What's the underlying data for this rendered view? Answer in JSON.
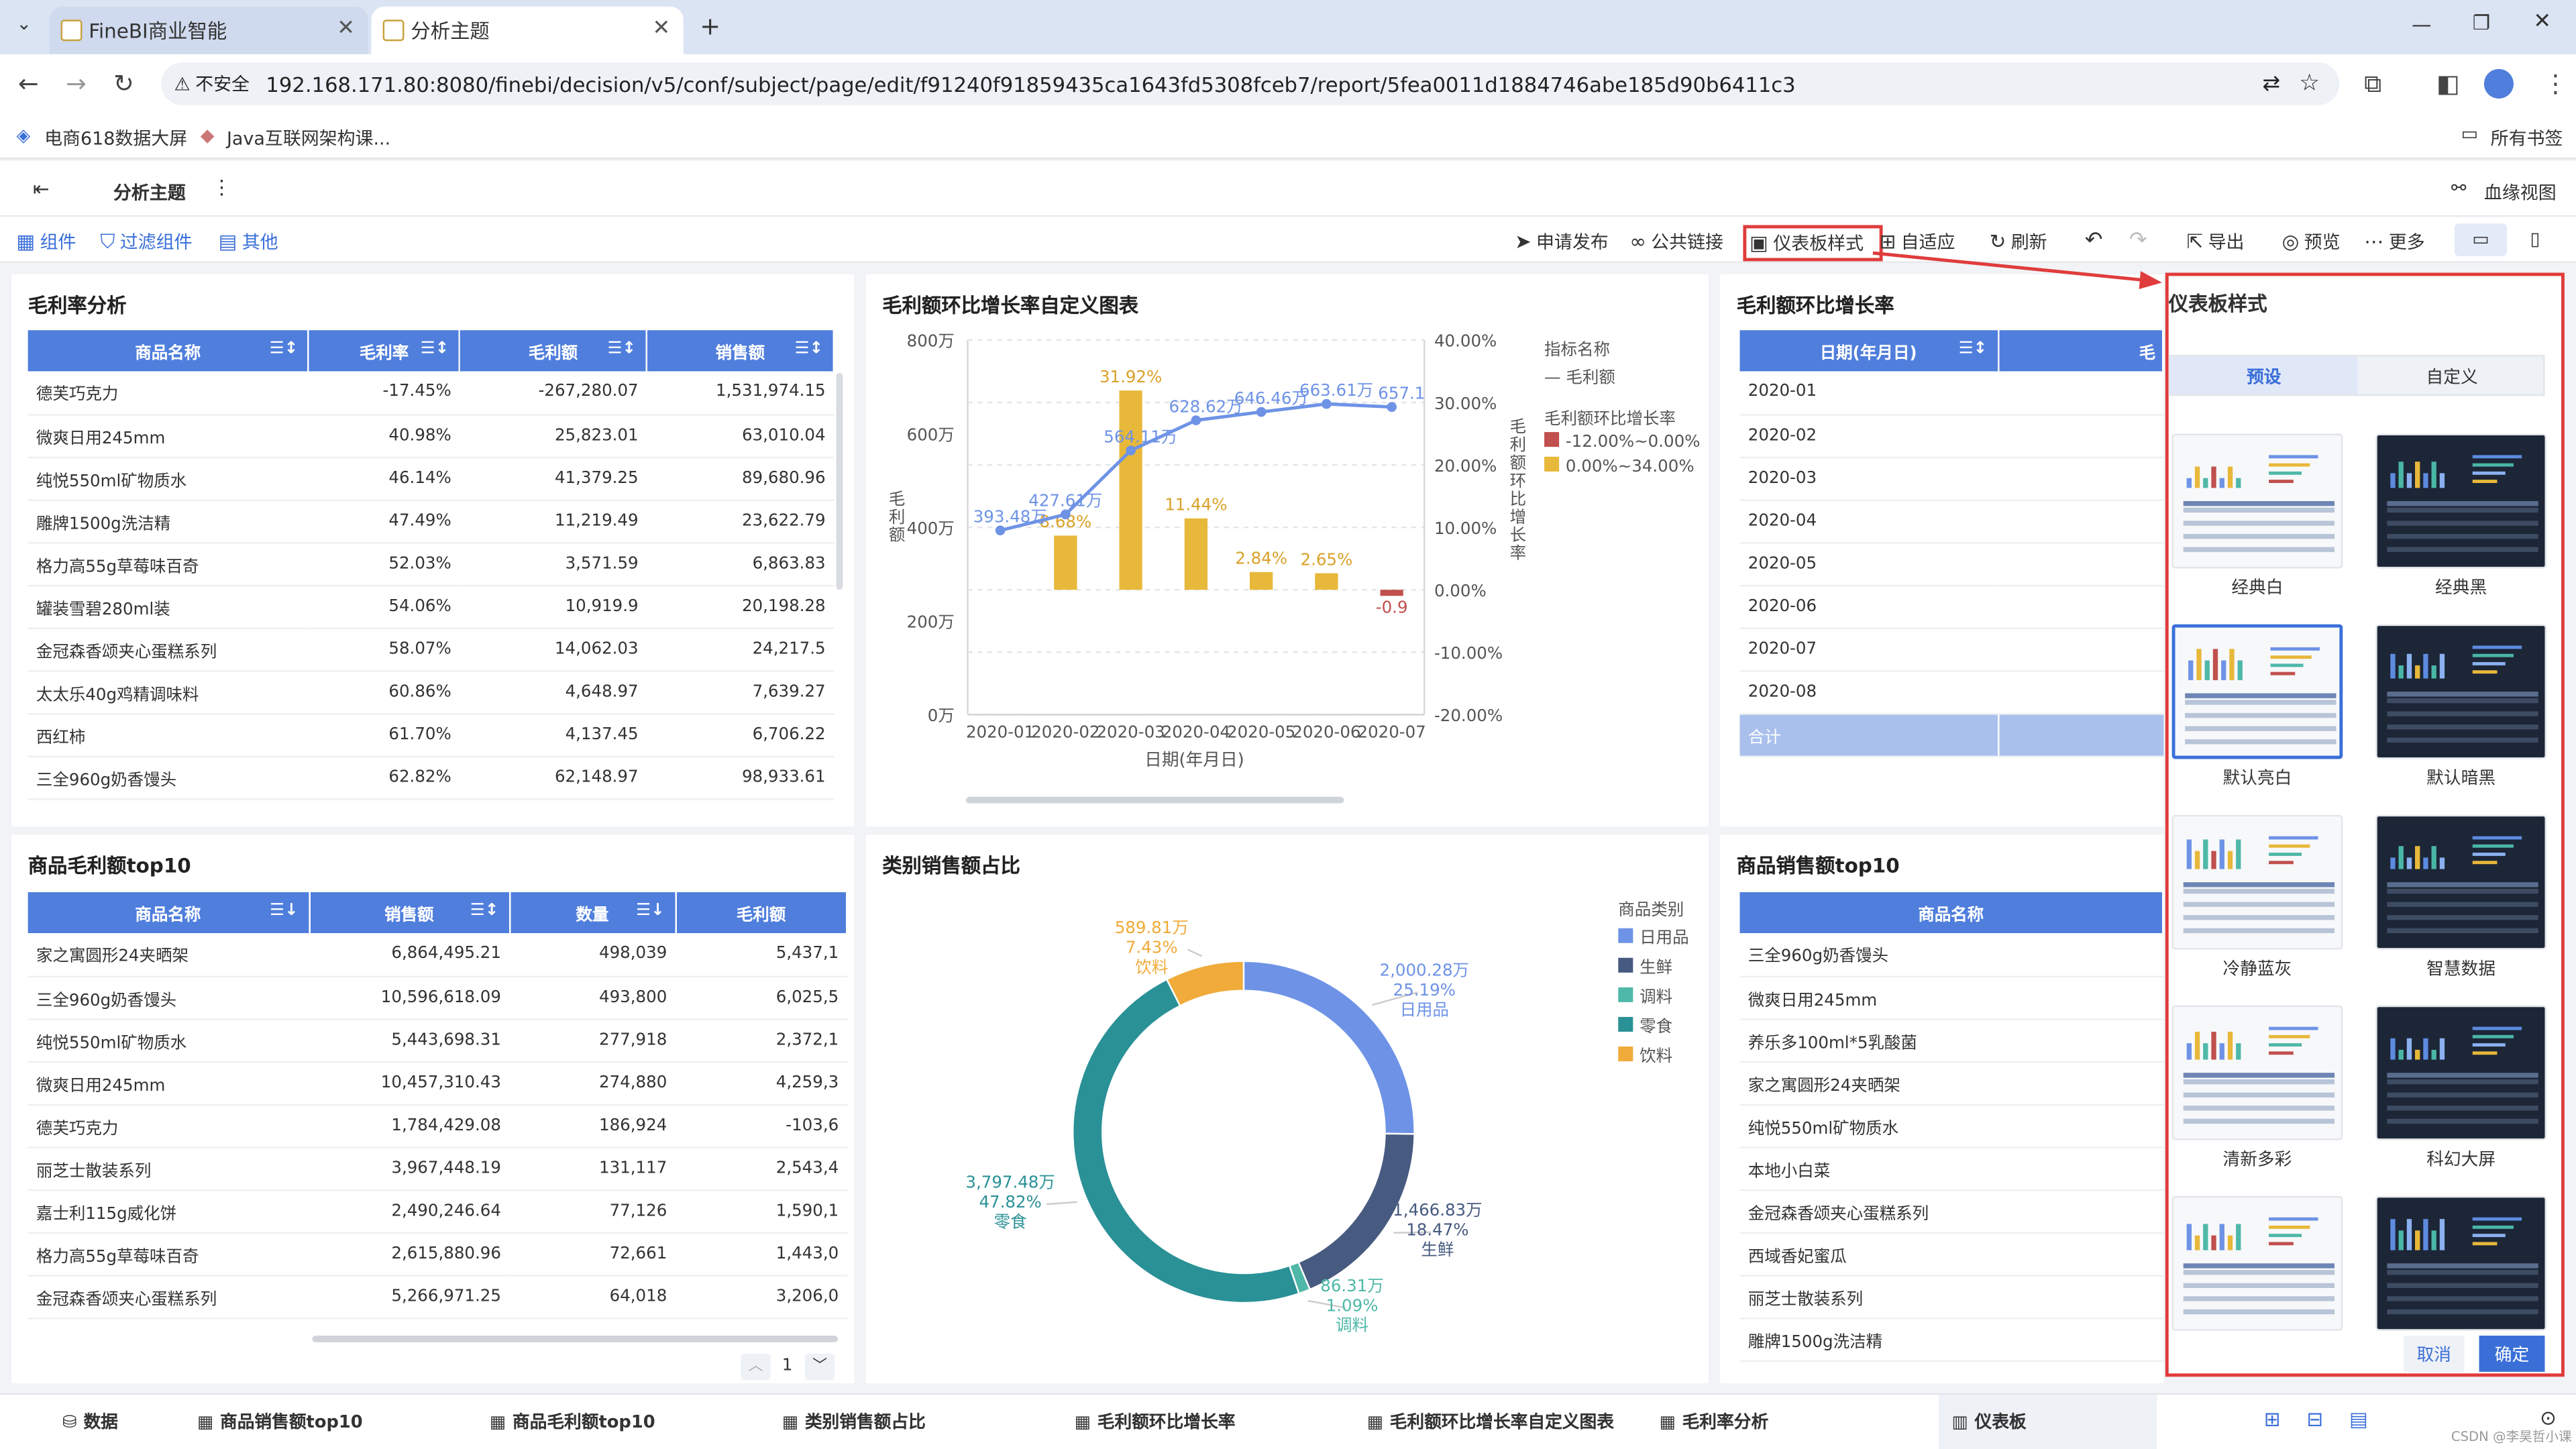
{
  "browser": {
    "tabs": [
      {
        "label": "FineBI商业智能"
      },
      {
        "label": "分析主题"
      }
    ],
    "insecure_label": "不安全",
    "url": "192.168.171.80:8080/finebi/decision/v5/conf/subject/page/edit/f91240f91859435ca1643fd5308fceb7/report/5fea0011d1884746abe185d90b6411c3",
    "bookmarks": [
      "电商618数据大屏",
      "Java互联网架构课..."
    ],
    "all_bookmarks": "所有书签"
  },
  "app": {
    "title": "分析主题",
    "lineage": "血缘视图"
  },
  "toolbar": {
    "left": [
      "组件",
      "过滤组件",
      "其他"
    ],
    "right": [
      "申请发布",
      "公共链接",
      "仪表板样式",
      "自适应",
      "刷新",
      "导出",
      "预览",
      "更多"
    ]
  },
  "gross_margin": {
    "title": "毛利率分析",
    "columns": [
      "商品名称",
      "毛利率",
      "毛利额",
      "销售额"
    ],
    "rows": [
      [
        "德芙巧克力",
        "-17.45%",
        "-267,280.07",
        "1,531,974.15"
      ],
      [
        "微爽日用245mm",
        "40.98%",
        "25,823.01",
        "63,010.04"
      ],
      [
        "纯悦550ml矿物质水",
        "46.14%",
        "41,379.25",
        "89,680.96"
      ],
      [
        "雕牌1500g洗洁精",
        "47.49%",
        "11,219.49",
        "23,622.79"
      ],
      [
        "格力高55g草莓味百奇",
        "52.03%",
        "3,571.59",
        "6,863.83"
      ],
      [
        "罐装雪碧280ml装",
        "54.06%",
        "10,919.9",
        "20,198.28"
      ],
      [
        "金冠森香颂夹心蛋糕系列",
        "58.07%",
        "14,062.03",
        "24,217.5"
      ],
      [
        "太太乐40g鸡精调味料",
        "60.86%",
        "4,648.97",
        "7,639.27"
      ],
      [
        "西红柿",
        "61.70%",
        "4,137.45",
        "6,706.22"
      ],
      [
        "三全960g奶香馒头",
        "62.82%",
        "62,148.97",
        "98,933.61"
      ]
    ]
  },
  "custom_chart": {
    "title": "毛利额环比增长率自定义图表",
    "xlabel": "日期(年月日)",
    "ylabel": "毛利额",
    "y2label": "毛利额环比增长率",
    "legend_title": "指标名称",
    "legend_line": "毛利额",
    "legend_bar_title": "毛利额环比增长率",
    "legend_bar_items": [
      "-12.00%~0.00%",
      "0.00%~34.00%"
    ],
    "left_ticks": [
      "800万",
      "600万",
      "400万",
      "200万",
      "0万"
    ],
    "right_ticks": [
      "40.00%",
      "30.00%",
      "20.00%",
      "10.00%",
      "0.00%",
      "-10.00%",
      "-20.00%"
    ]
  },
  "chart_data": {
    "type": "bar",
    "categories": [
      "2020-01",
      "2020-02",
      "2020-03",
      "2020-04",
      "2020-05",
      "2020-06",
      "2020-07"
    ],
    "series": [
      {
        "name": "毛利额",
        "type": "line",
        "values": [
          393.48,
          427.61,
          564.11,
          628.62,
          646.46,
          663.61,
          657.1
        ],
        "labels": [
          "393.48万",
          "427.61万",
          "564.11万",
          "628.62万",
          "646.46万",
          "663.61万",
          "657.1"
        ]
      },
      {
        "name": "毛利额环比增长率",
        "type": "bar",
        "values": [
          null,
          8.68,
          31.92,
          11.44,
          2.84,
          2.65,
          -0.97
        ],
        "labels": [
          "",
          "8.68%",
          "31.92%",
          "11.44%",
          "2.84%",
          "2.65%",
          "-0.9"
        ]
      }
    ],
    "ylim": [
      0,
      800
    ],
    "y2lim": [
      -20,
      40
    ],
    "colors": {
      "line": "#6e93e6",
      "bar_pos": "#e8b83a",
      "bar_neg": "#c0504d"
    }
  },
  "growth_rate": {
    "title": "毛利额环比增长率",
    "column": "日期(年月日)",
    "column2": "毛",
    "rows": [
      "2020-01",
      "2020-02",
      "2020-03",
      "2020-04",
      "2020-05",
      "2020-06",
      "2020-07",
      "2020-08"
    ],
    "total": "合计"
  },
  "top10_margin": {
    "title": "商品毛利额top10",
    "columns": [
      "商品名称",
      "销售额",
      "数量",
      "毛利额"
    ],
    "rows": [
      [
        "家之寓圆形24夹晒架",
        "6,864,495.21",
        "498,039",
        "5,437,1"
      ],
      [
        "三全960g奶香馒头",
        "10,596,618.09",
        "493,800",
        "6,025,5"
      ],
      [
        "纯悦550ml矿物质水",
        "5,443,698.31",
        "277,918",
        "2,372,1"
      ],
      [
        "微爽日用245mm",
        "10,457,310.43",
        "274,880",
        "4,259,3"
      ],
      [
        "德芙巧克力",
        "1,784,429.08",
        "186,924",
        "-103,6"
      ],
      [
        "丽芝士散装系列",
        "3,967,448.19",
        "131,117",
        "2,543,4"
      ],
      [
        "嘉士利115g威化饼",
        "2,490,246.64",
        "77,126",
        "1,590,1"
      ],
      [
        "格力高55g草莓味百奇",
        "2,615,880.96",
        "72,661",
        "1,443,0"
      ],
      [
        "金冠森香颂夹心蛋糕系列",
        "5,266,971.25",
        "64,018",
        "3,206,0"
      ]
    ],
    "page": "1"
  },
  "category_pie": {
    "title": "类别销售额占比",
    "legend_title": "商品类别",
    "slices": [
      {
        "name": "日用品",
        "value": "2,000.28万",
        "pct": "25.19%",
        "color": "#6e93e6",
        "frac": 0.2519
      },
      {
        "name": "生鲜",
        "value": "1,466.83万",
        "pct": "18.47%",
        "color": "#475a80",
        "frac": 0.1847
      },
      {
        "name": "调料",
        "value": "86.31万",
        "pct": "1.09%",
        "color": "#4fb8a8",
        "frac": 0.0109
      },
      {
        "name": "零食",
        "value": "3,797.48万",
        "pct": "47.82%",
        "color": "#2a9196",
        "frac": 0.4782
      },
      {
        "name": "饮料",
        "value": "589.81万",
        "pct": "7.43%",
        "color": "#f0ab3a",
        "frac": 0.0743
      }
    ]
  },
  "top10_sales": {
    "title": "商品销售额top10",
    "column": "商品名称",
    "rows": [
      "三全960g奶香馒头",
      "微爽日用245mm",
      "养乐多100ml*5乳酸菌",
      "家之寓圆形24夹晒架",
      "纯悦550ml矿物质水",
      "本地小白菜",
      "金冠森香颂夹心蛋糕系列",
      "西域香妃蜜瓜",
      "丽芝士散装系列",
      "雕牌1500g洗洁精"
    ]
  },
  "style_panel": {
    "title": "仪表板样式",
    "tabs": [
      "预设",
      "自定义"
    ],
    "themes": [
      {
        "name": "经典白",
        "dark": false
      },
      {
        "name": "经典黑",
        "dark": true
      },
      {
        "name": "默认亮白",
        "dark": false
      },
      {
        "name": "默认暗黑",
        "dark": true
      },
      {
        "name": "冷静蓝灰",
        "dark": false
      },
      {
        "name": "智慧数据",
        "dark": true
      },
      {
        "name": "清新多彩",
        "dark": false
      },
      {
        "name": "科幻大屏",
        "dark": true
      },
      {
        "name": "",
        "dark": false
      },
      {
        "name": "",
        "dark": true
      }
    ],
    "cancel": "取消",
    "confirm": "确定"
  },
  "bottom_tabs": [
    "数据",
    "商品销售额top10",
    "商品毛利额top10",
    "类别销售额占比",
    "毛利额环比增长率",
    "毛利额环比增长率自定义图表",
    "毛利率分析",
    "仪表板"
  ],
  "watermark": "CSDN @李昊哲小课"
}
